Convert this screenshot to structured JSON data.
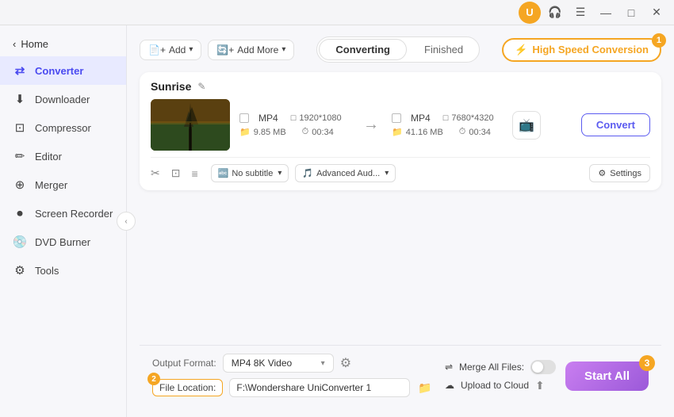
{
  "titlebar": {
    "user_icon_label": "U",
    "headphone_icon": "🎧",
    "minimize_label": "—",
    "maximize_label": "□",
    "close_label": "✕",
    "badge1_label": "1"
  },
  "sidebar": {
    "back_label": "Home",
    "items": [
      {
        "id": "converter",
        "label": "Converter",
        "icon": "⇄",
        "active": true
      },
      {
        "id": "downloader",
        "label": "Downloader",
        "icon": "⬇"
      },
      {
        "id": "compressor",
        "label": "Compressor",
        "icon": "⊡"
      },
      {
        "id": "editor",
        "label": "Editor",
        "icon": "✏"
      },
      {
        "id": "merger",
        "label": "Merger",
        "icon": "⊕"
      },
      {
        "id": "screen-recorder",
        "label": "Screen Recorder",
        "icon": "⏺"
      },
      {
        "id": "dvd-burner",
        "label": "DVD Burner",
        "icon": "💿"
      },
      {
        "id": "tools",
        "label": "Tools",
        "icon": "⚙"
      }
    ]
  },
  "toolbar": {
    "add_btn_label": "Add",
    "add_more_label": "Add More",
    "converting_tab": "Converting",
    "finished_tab": "Finished",
    "speed_btn_label": "High Speed Conversion",
    "speed_badge": "1"
  },
  "file": {
    "title": "Sunrise",
    "input": {
      "format": "MP4",
      "resolution": "1920*1080",
      "size": "9.85 MB",
      "duration": "00:34"
    },
    "output": {
      "format": "MP4",
      "resolution": "7680*4320",
      "size": "41.16 MB",
      "duration": "00:34"
    },
    "convert_btn": "Convert",
    "subtitle_label": "No subtitle",
    "audio_label": "Advanced Aud...",
    "settings_label": "Settings"
  },
  "bottom": {
    "output_format_label": "Output Format:",
    "output_format_value": "MP4 8K Video",
    "file_location_label": "File Location:",
    "file_location_badge": "2",
    "file_path_value": "F:\\Wondershare UniConverter 1",
    "merge_files_label": "Merge All Files:",
    "upload_cloud_label": "Upload to Cloud",
    "start_btn_label": "Start All",
    "start_badge": "3"
  }
}
